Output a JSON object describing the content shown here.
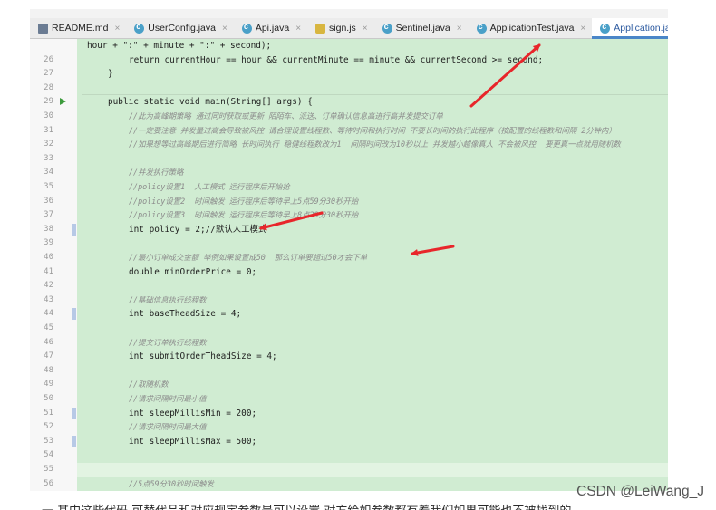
{
  "tabs": [
    {
      "label": "README.md",
      "icon": "markdown-file-icon",
      "active": false
    },
    {
      "label": "UserConfig.java",
      "icon": "java-class-icon",
      "active": false
    },
    {
      "label": "Api.java",
      "icon": "java-class-icon",
      "active": false
    },
    {
      "label": "sign.js",
      "icon": "javascript-file-icon",
      "active": false
    },
    {
      "label": "Sentinel.java",
      "icon": "java-class-icon",
      "active": false
    },
    {
      "label": "ApplicationTest.java",
      "icon": "java-class-icon",
      "active": false
    },
    {
      "label": "Application.java",
      "icon": "java-class-icon",
      "active": true
    }
  ],
  "tab_close_glyph": "×",
  "code_lines": [
    {
      "n": "",
      "text": "hour + \":\" + minute + \":\" + second);",
      "kind": "code",
      "indent": 0
    },
    {
      "n": "26",
      "text": "return currentHour == hour && currentMinute == minute && currentSecond >= second;",
      "kind": "code",
      "indent": 2
    },
    {
      "n": "27",
      "text": "}",
      "kind": "code",
      "indent": 1
    },
    {
      "n": "28",
      "text": "",
      "kind": "code",
      "indent": 0
    },
    {
      "n": "29",
      "text": "public static void main(String[] args) {",
      "kind": "code",
      "indent": 1,
      "run": true
    },
    {
      "n": "30",
      "text": "//此为高峰期策略 通过同时获取或更新 陌陌车、派送、订单确认信息高进行高并发提交订单",
      "kind": "comment",
      "indent": 2
    },
    {
      "n": "31",
      "text": "//一定要注意 并发量过高会导致被风控 请合理设置线程数、等待时间和执行时间 不要长时间的执行此程序（按配置的线程数和间隔 2分钟内）",
      "kind": "comment",
      "indent": 2
    },
    {
      "n": "32",
      "text": "//如果想等过高峰期后进行简略 长时间执行 稳健线程数改为1  间隔时间改为10秒以上 并发越小越像真人 不会被风控  要更真一点就用随机数",
      "kind": "comment",
      "indent": 2
    },
    {
      "n": "33",
      "text": "",
      "kind": "code",
      "indent": 0
    },
    {
      "n": "34",
      "text": "//并发执行策略",
      "kind": "comment",
      "indent": 2
    },
    {
      "n": "35",
      "text": "//policy设置1  人工模式 运行程序后开始抢",
      "kind": "comment",
      "indent": 2
    },
    {
      "n": "36",
      "text": "//policy设置2  时间触发 运行程序后等待早上5点59分30秒开始",
      "kind": "comment",
      "indent": 2
    },
    {
      "n": "37",
      "text": "//policy设置3  时间触发 运行程序后等待早上8点29分30秒开始",
      "kind": "comment",
      "indent": 2
    },
    {
      "n": "38",
      "text": "int policy = 2;//默认人工模式",
      "kind": "code",
      "indent": 2,
      "marker": true
    },
    {
      "n": "39",
      "text": "",
      "kind": "code",
      "indent": 0
    },
    {
      "n": "40",
      "text": "//最小订单成交金额 举例如果设置成50  那么订单要超过50才会下单",
      "kind": "comment",
      "indent": 2
    },
    {
      "n": "41",
      "text": "double minOrderPrice = 0;",
      "kind": "code",
      "indent": 2
    },
    {
      "n": "42",
      "text": "",
      "kind": "code",
      "indent": 0
    },
    {
      "n": "43",
      "text": "//基础信息执行线程数",
      "kind": "comment",
      "indent": 2
    },
    {
      "n": "44",
      "text": "int baseTheadSize = 4;",
      "kind": "code",
      "indent": 2,
      "marker": true
    },
    {
      "n": "45",
      "text": "",
      "kind": "code",
      "indent": 0
    },
    {
      "n": "46",
      "text": "//提交订单执行线程数",
      "kind": "comment",
      "indent": 2
    },
    {
      "n": "47",
      "text": "int submitOrderTheadSize = 4;",
      "kind": "code",
      "indent": 2
    },
    {
      "n": "48",
      "text": "",
      "kind": "code",
      "indent": 0
    },
    {
      "n": "49",
      "text": "//取随机数",
      "kind": "comment",
      "indent": 2
    },
    {
      "n": "50",
      "text": "//请求间隔时间最小值",
      "kind": "comment",
      "indent": 2
    },
    {
      "n": "51",
      "text": "int sleepMillisMin = 200;",
      "kind": "code",
      "indent": 2,
      "marker": true
    },
    {
      "n": "52",
      "text": "//请求间隔时间最大值",
      "kind": "comment",
      "indent": 2
    },
    {
      "n": "53",
      "text": "int sleepMillisMax = 500;",
      "kind": "code",
      "indent": 2,
      "marker": true
    },
    {
      "n": "54",
      "text": "",
      "kind": "code",
      "indent": 0
    },
    {
      "n": "55",
      "text": "",
      "kind": "code",
      "indent": 0,
      "current": true
    },
    {
      "n": "56",
      "text": "//5点59分30秒时间触发",
      "kind": "comment",
      "indent": 2
    }
  ],
  "watermark": "CSDN @LeiWang_J",
  "footer_text": "一 其中这些代码 可替代品和对应规定参数是可以设置 对方给如参数都有着我们如果可能也不被找到的",
  "colors": {
    "code_background": "#d0ecd2",
    "arrow_red": "#e8262b",
    "active_tab": "#2c5aa0"
  }
}
